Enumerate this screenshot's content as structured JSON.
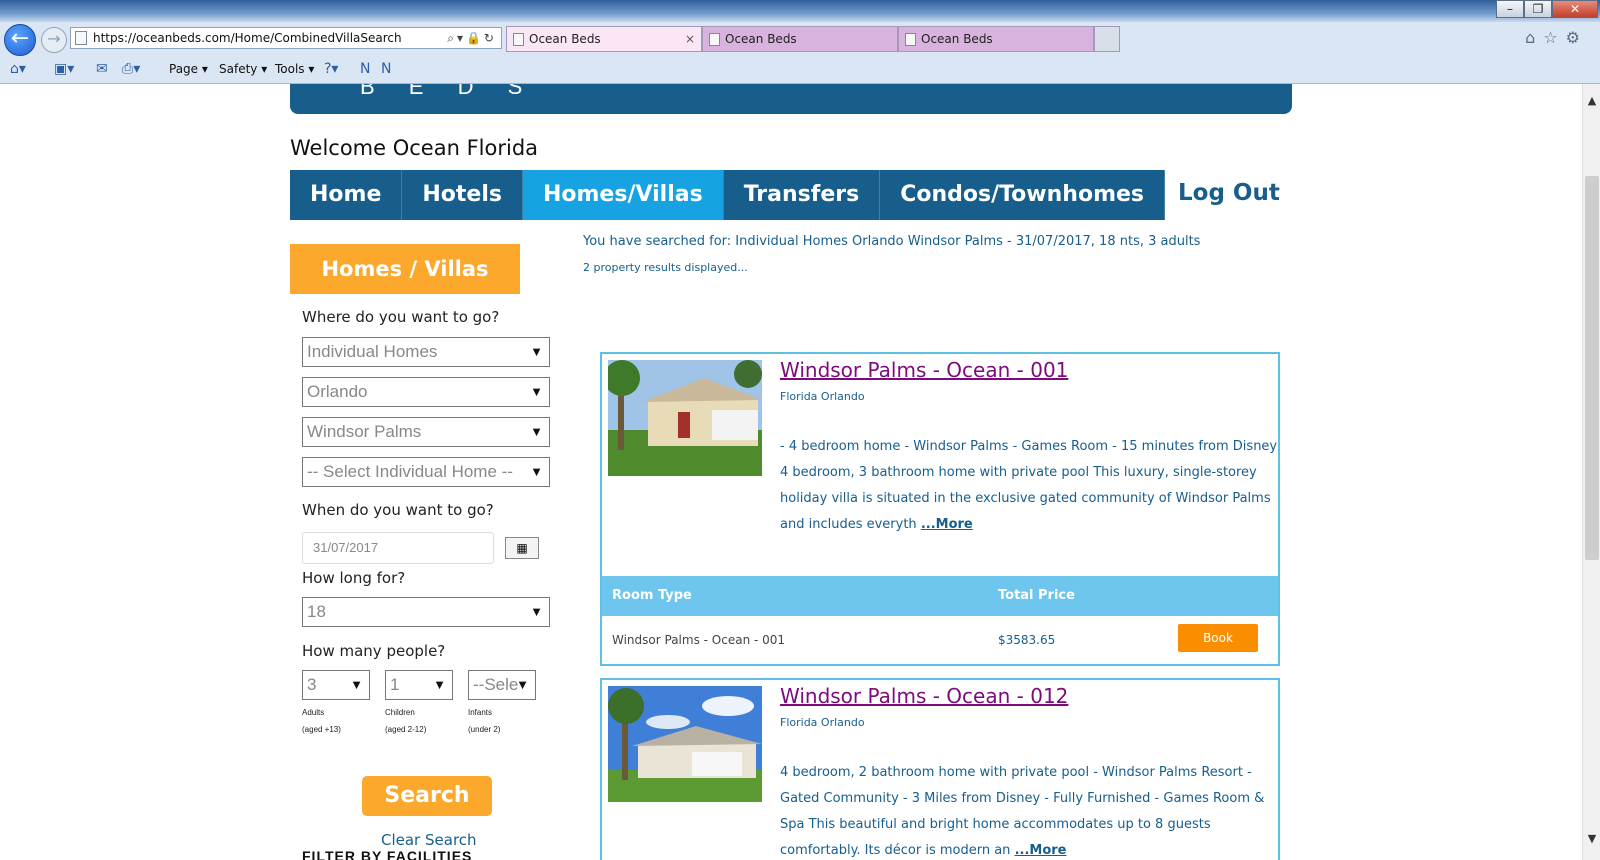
{
  "browser": {
    "url": "https://oceanbeds.com/Home/CombinedVillaSearch",
    "tabs": [
      "Ocean Beds",
      "Ocean Beds",
      "Ocean Beds"
    ],
    "tab_close": "×",
    "commands": {
      "page": "Page",
      "safety": "Safety",
      "tools": "Tools"
    }
  },
  "page": {
    "banner_text": "B E D S",
    "welcome": "Welcome Ocean Florida",
    "nav": [
      "Home",
      "Hotels",
      "Homes/Villas",
      "Transfers",
      "Condos/Townhomes"
    ],
    "nav_active": "Homes/Villas",
    "logout": "Log Out"
  },
  "sidebar": {
    "header": "Homes / Villas",
    "where_label": "Where do you want to go?",
    "type_select": "Individual Homes",
    "city_select": "Orlando",
    "resort_select": "Windsor Palms",
    "home_select": "-- Select Individual Home --",
    "when_label": "When do you want to go?",
    "date_value": "31/07/2017",
    "howlong_label": "How long for?",
    "nights_select": "18",
    "people_label": "How many people?",
    "adults_select": "3",
    "children_select": "1",
    "infants_select": "--Sele",
    "adults_label": "Adults",
    "adults_sub": "(aged +13)",
    "children_label": "Children",
    "children_sub": "(aged 2-12)",
    "infants_label": "Infants",
    "infants_sub": "(under 2)",
    "search_button": "Search",
    "clear_search": "Clear Search",
    "filter_label": "FILTER BY FACILITIES"
  },
  "results": {
    "summary": "You have searched for: Individual Homes Orlando Windsor Palms - 31/07/2017, 18 nts, 3 adults",
    "count_text": "2 property results displayed...",
    "more_label": "...More",
    "room_type_header": "Room Type",
    "total_price_header": "Total Price",
    "book_label": "Book",
    "items": [
      {
        "title": "Windsor Palms - Ocean - 001",
        "location": "Florida Orlando",
        "description": "- 4 bedroom home - Windsor Palms - Games Room - 15 minutes from Disney 4 bedroom, 3 bathroom home with private pool This luxury, single-storey holiday villa is situated in the exclusive gated community of Windsor Palms and includes everyth",
        "room_type": "Windsor Palms - Ocean - 001",
        "total_price": "$3583.65"
      },
      {
        "title": "Windsor Palms - Ocean - 012",
        "location": "Florida Orlando",
        "description": "4 bedroom, 2 bathroom home with private pool - Windsor Palms Resort - Gated Community - 3 Miles from Disney - Fully Furnished - Games Room & Spa This beautiful and bright home accommodates up to 8 guests comfortably. Its décor is modern an"
      }
    ]
  },
  "colors": {
    "brand_blue": "#175e8c",
    "nav_active": "#17a2e2",
    "accent_orange": "#fca82d",
    "book_orange": "#fa8e00",
    "card_border": "#5fc0e6",
    "title_purple": "#7d0b7d"
  }
}
